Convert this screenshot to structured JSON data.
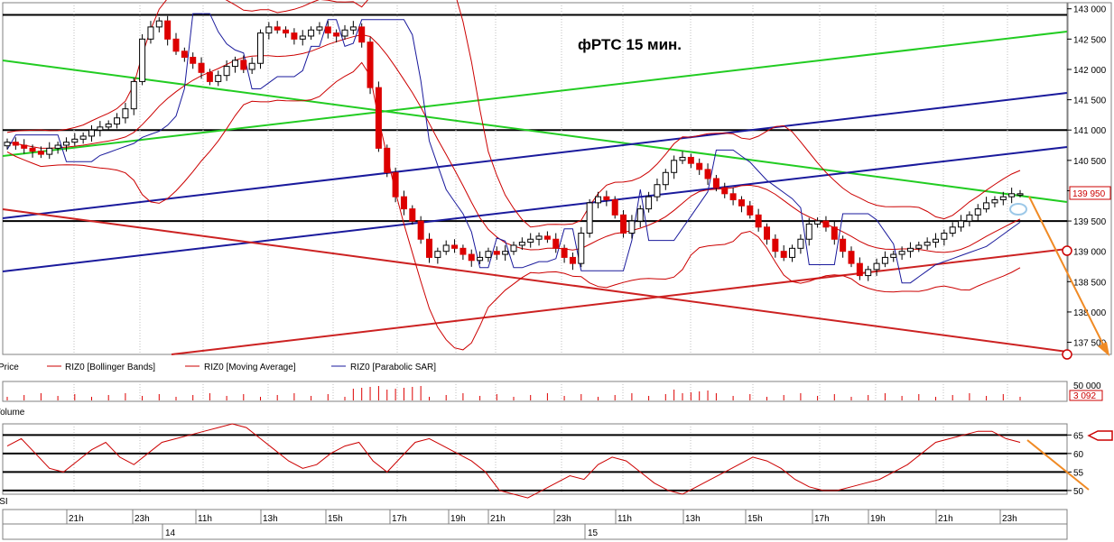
{
  "chart_data": [
    {
      "type": "candlestick",
      "title": "фРТС   15 мин.",
      "legend": [
        {
          "name": "Price",
          "color": "#000000"
        },
        {
          "name": "RIZ0 [Bollinger Bands]",
          "color": "#cc0000"
        },
        {
          "name": "RIZ0 [Moving Average]",
          "color": "#cc0000"
        },
        {
          "name": "RIZ0 [Parabolic SAR]",
          "color": "#1a1a9c"
        }
      ],
      "y_ticks": [
        "143 000",
        "142 500",
        "142 000",
        "141 500",
        "141 000",
        "140 500",
        "140 000",
        "139 500",
        "139 000",
        "138 500",
        "138 000",
        "137 500"
      ],
      "ylim": [
        137300,
        143100
      ],
      "last_price_label": "139 950",
      "last_price": 139950,
      "horizontal_levels": [
        142900,
        141000,
        139500
      ],
      "close_series": [
        140800,
        140750,
        140700,
        140650,
        140600,
        140700,
        140750,
        140800,
        140850,
        140900,
        141000,
        141050,
        141100,
        141200,
        141350,
        141800,
        142500,
        142700,
        142800,
        142500,
        142300,
        142200,
        142100,
        141950,
        141800,
        141900,
        142050,
        142150,
        142000,
        142100,
        142600,
        142700,
        142650,
        142600,
        142500,
        142550,
        142650,
        142700,
        142600,
        142550,
        142650,
        142700,
        142450,
        141700,
        140700,
        140300,
        139900,
        139700,
        139500,
        139200,
        138900,
        139000,
        139100,
        139050,
        138950,
        138850,
        138900,
        139000,
        138950,
        139000,
        139100,
        139150,
        139200,
        139250,
        139200,
        139050,
        138900,
        138800,
        139300,
        139800,
        139900,
        139850,
        139600,
        139300,
        139500,
        139700,
        139900,
        140100,
        140300,
        140500,
        140550,
        140450,
        140350,
        140200,
        140050,
        139950,
        139850,
        139750,
        139600,
        139400,
        139200,
        139000,
        138900,
        139050,
        139200,
        139450,
        139500,
        139400,
        139200,
        139000,
        138800,
        138600,
        138700,
        138800,
        138900,
        138950,
        139000,
        139050,
        139100,
        139150,
        139200,
        139300,
        139400,
        139500,
        139600,
        139700,
        139800,
        139850,
        139900,
        139950,
        139950
      ]
    },
    {
      "type": "bar",
      "ylabel": "Volume",
      "y_ticks": [
        "50 000"
      ],
      "last_value_label": "3 092"
    },
    {
      "type": "line",
      "ylabel": "RSI",
      "y_ticks": [
        "65",
        "60",
        "55",
        "50"
      ],
      "ylim": [
        49,
        68
      ],
      "levels": [
        65,
        60,
        55,
        50
      ],
      "values": [
        62,
        64,
        60,
        56,
        55,
        58,
        61,
        63,
        59,
        57,
        60,
        63,
        64,
        65,
        66,
        67,
        68,
        67,
        64,
        61,
        58,
        56,
        57,
        60,
        62,
        63,
        58,
        55,
        59,
        63,
        64,
        62,
        60,
        58,
        55,
        50,
        49,
        48,
        50,
        52,
        54,
        53,
        57,
        59,
        58,
        55,
        52,
        50,
        49,
        51,
        53,
        55,
        57,
        59,
        58,
        56,
        53,
        51,
        50,
        50,
        51,
        52,
        53,
        55,
        57,
        60,
        63,
        64,
        65,
        66,
        66,
        64,
        63
      ]
    }
  ],
  "x_axis": {
    "hour_labels": [
      "21h",
      "23h",
      "11h",
      "13h",
      "15h",
      "17h",
      "19h",
      "21h",
      "23h",
      "11h",
      "13h",
      "15h",
      "17h",
      "19h",
      "21h",
      "23h"
    ],
    "day_labels": [
      "14",
      "15"
    ]
  }
}
